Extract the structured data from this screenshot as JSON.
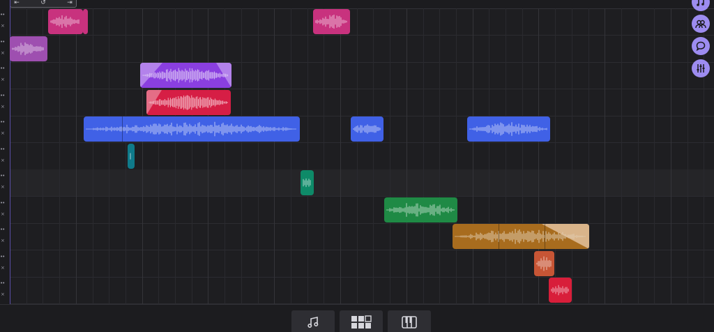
{
  "app": {
    "accent": "#9d8cf0",
    "background": "#1e1e21"
  },
  "toolbar": {
    "buttons": [
      {
        "name": "loop-start-icon",
        "glyph": "⇤"
      },
      {
        "name": "undo-icon",
        "glyph": "↺"
      },
      {
        "name": "loop-end-icon",
        "glyph": "⇥"
      }
    ]
  },
  "track_controls": {
    "dots_glyph": "••",
    "close_glyph": "×"
  },
  "track_count": 11,
  "clips": [
    {
      "track": 0,
      "color": "#c8327e",
      "segments": 1
    },
    {
      "track": 0,
      "color": "#c8327e",
      "segments": 1
    },
    {
      "track": 0,
      "color": "#c8327e",
      "segments": 1
    },
    {
      "track": 1,
      "color": "#9e4fb0",
      "segments": 1
    },
    {
      "track": 2,
      "color": "#8a3fe0",
      "segments": 1,
      "fade": "both"
    },
    {
      "track": 3,
      "color": "#d61e45",
      "segments": 1,
      "fade": "in"
    },
    {
      "track": 4,
      "color": "#4061e6",
      "segments": 2
    },
    {
      "track": 4,
      "color": "#4061e6",
      "segments": 1
    },
    {
      "track": 4,
      "color": "#4061e6",
      "segments": 1
    },
    {
      "track": 5,
      "color": "#0f7a8a",
      "segments": 1
    },
    {
      "track": 6,
      "color": "#0e8a68",
      "segments": 1
    },
    {
      "track": 7,
      "color": "#1f8a45",
      "segments": 1
    },
    {
      "track": 8,
      "color": "#a86c1e",
      "segments": 3,
      "fade": "out"
    },
    {
      "track": 9,
      "color": "#c75535",
      "segments": 1
    },
    {
      "track": 10,
      "color": "#d81e3a",
      "segments": 1
    }
  ],
  "right_rail": [
    {
      "name": "notes-icon",
      "glyph": "♫"
    },
    {
      "name": "collaborators-icon",
      "glyph": "users"
    },
    {
      "name": "chat-icon",
      "glyph": "chat"
    },
    {
      "name": "mixer-icon",
      "glyph": "sliders"
    }
  ],
  "bottom_bar": [
    {
      "name": "notes-view-button",
      "glyph": "♫"
    },
    {
      "name": "grid-view-button",
      "glyph": "grid"
    },
    {
      "name": "piano-view-button",
      "glyph": "piano"
    }
  ]
}
